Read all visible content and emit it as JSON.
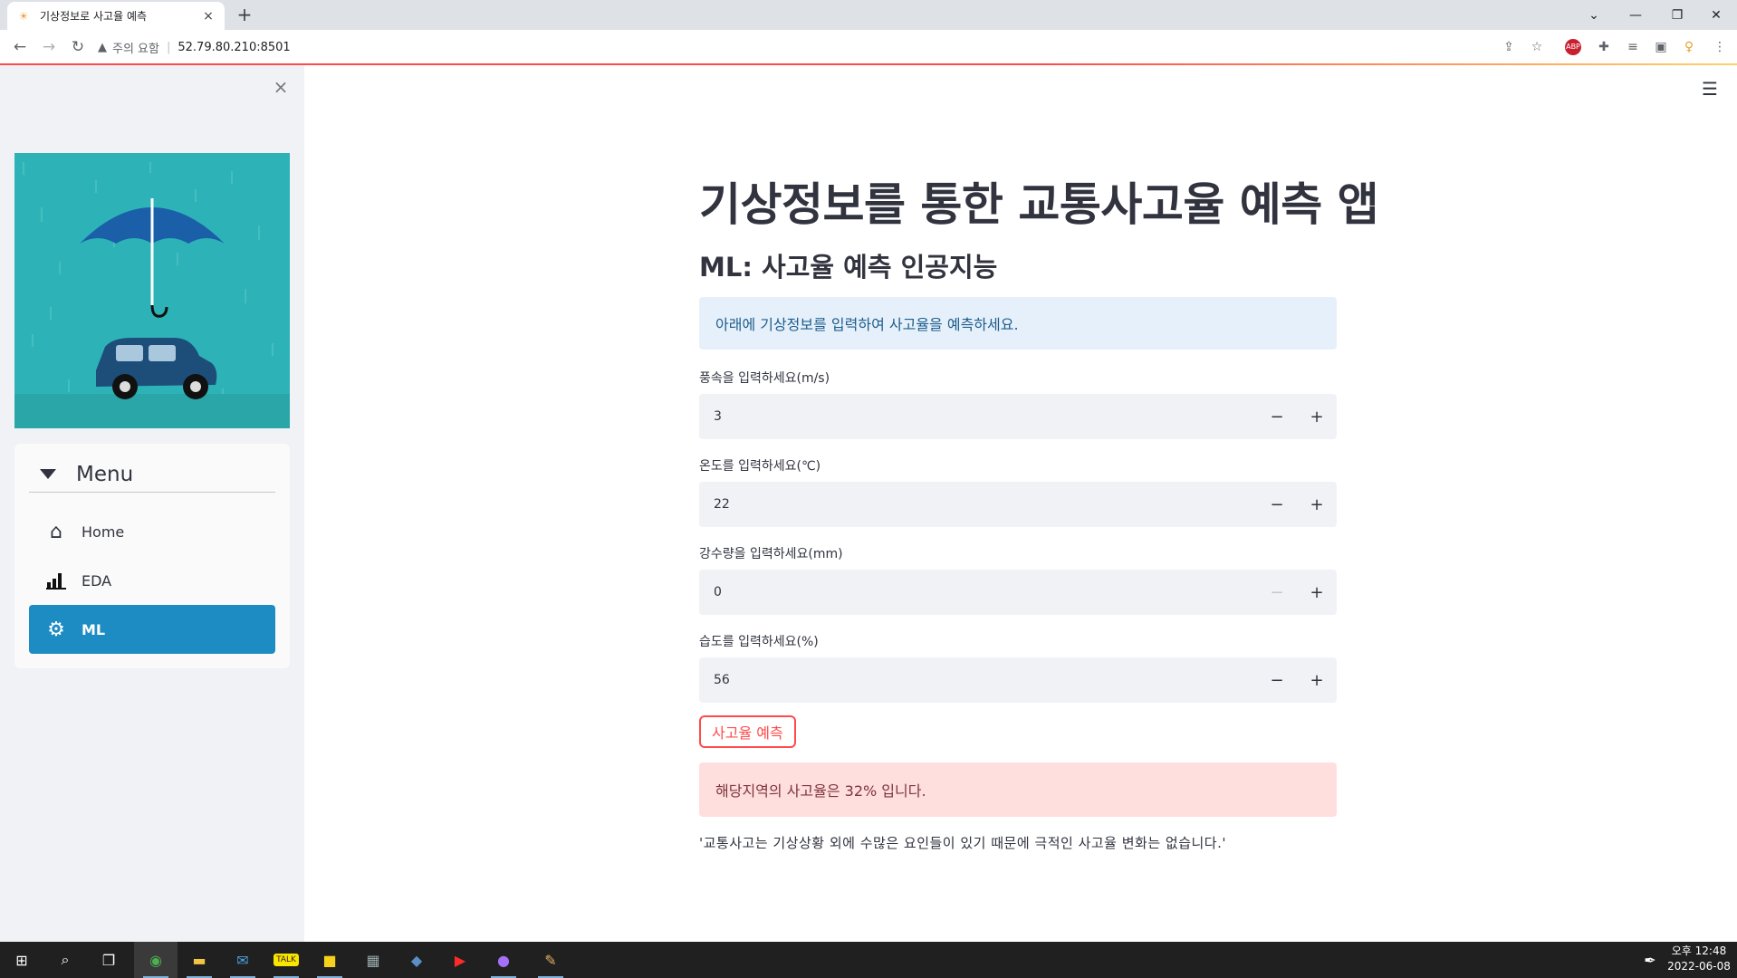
{
  "browser": {
    "tab_title": "기상정보로 사고율 예측",
    "tab_close": "×",
    "new_tab": "+",
    "security_label": "주의 요함",
    "url": "52.79.80.210:8501"
  },
  "sidebar": {
    "close": "×",
    "menu_title": "Menu",
    "items": [
      {
        "label": "Home",
        "icon": "home-icon",
        "active": false
      },
      {
        "label": "EDA",
        "icon": "bar-chart-icon",
        "active": false
      },
      {
        "label": "ML",
        "icon": "gear-icon",
        "active": true
      }
    ]
  },
  "main": {
    "title": "기상정보를 통한 교통사고율 예측 앱",
    "subtitle": "ML: 사고율 예측 인공지능",
    "info": "아래에 기상정보를 입력하여 사고율을 예측하세요.",
    "fields": [
      {
        "label": "풍속을 입력하세요(m/s)",
        "value": "3"
      },
      {
        "label": "온도를 입력하세요(℃)",
        "value": "22"
      },
      {
        "label": "강수량을 입력하세요(mm)",
        "value": "0"
      },
      {
        "label": "습도를 입력하세요(%)",
        "value": "56"
      }
    ],
    "minus": "−",
    "plus": "+",
    "predict_button": "사고율 예측",
    "result": "해당지역의 사고율은 32% 입니다.",
    "note": "'교통사고는 기상상황 외에 수많은 요인들이 있기 때문에 극적인 사고율 변화는 없습니다.'"
  },
  "taskbar": {
    "time": "오후 12:48",
    "date": "2022-06-08"
  },
  "colors": {
    "accent": "#ff4b4b",
    "active_menu": "#1d8cc3",
    "info_bg": "#e6f0fb",
    "error_bg": "#ffdede"
  }
}
